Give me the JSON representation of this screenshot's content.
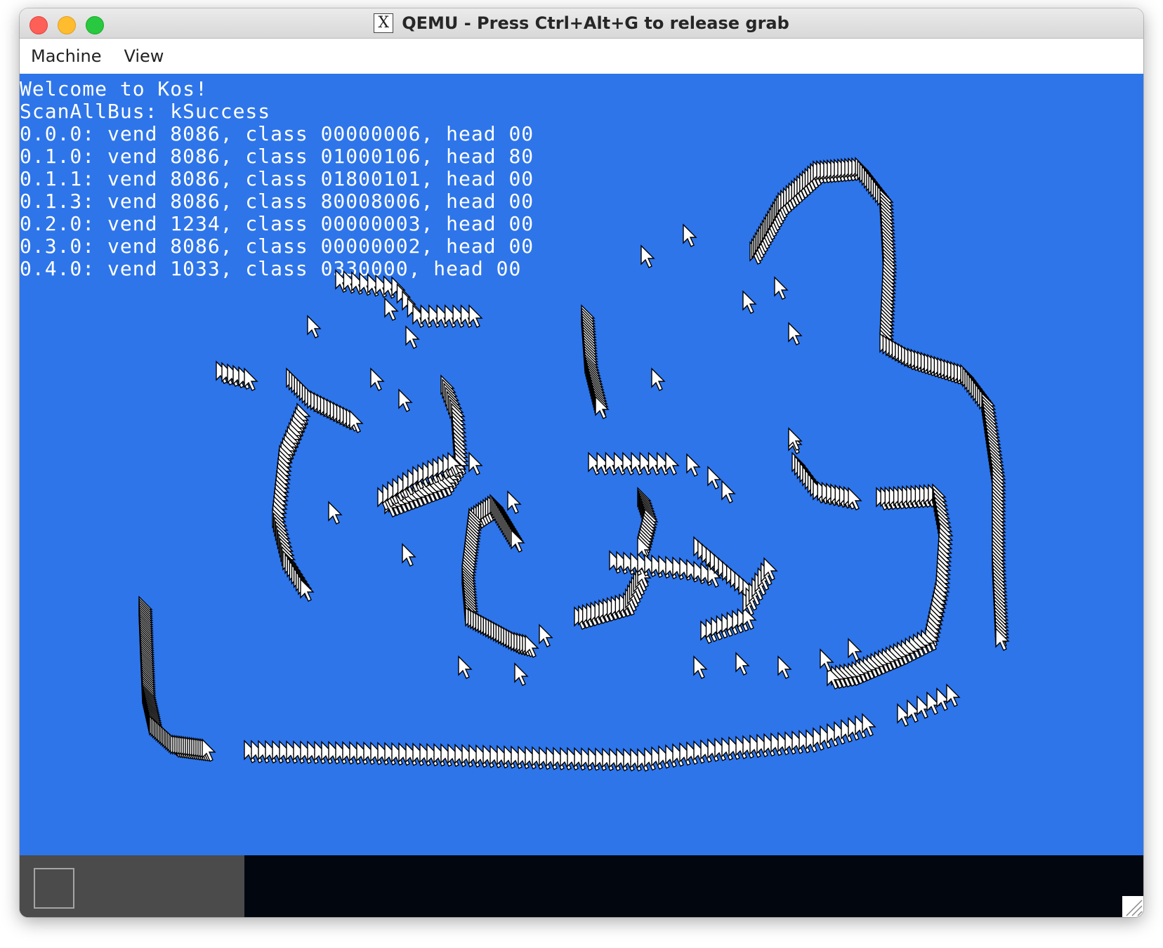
{
  "window": {
    "title": "QEMU - Press Ctrl+Alt+G to release grab",
    "x_icon_glyph": "X"
  },
  "menu": {
    "items": [
      "Machine",
      "View"
    ]
  },
  "console": {
    "lines": [
      "Welcome to Kos!",
      "ScanAllBus: kSuccess",
      "0.0.0: vend 8086, class 00000006, head 00",
      "0.1.0: vend 8086, class 01000106, head 80",
      "0.1.1: vend 8086, class 01800101, head 00",
      "0.1.3: vend 8086, class 80008006, head 00",
      "0.2.0: vend 1234, class 00000003, head 00",
      "0.3.0: vend 8086, class 00000002, head 00",
      "0.4.0: vend 1033, class 0330000, head 00"
    ]
  },
  "colors": {
    "screen_background": "#2e75ea",
    "console_text": "#ffffff",
    "taskbar": "#02070f",
    "task_panel": "#4b4b4b",
    "cursor_fill": "#ffffff",
    "cursor_outline": "#000000"
  },
  "icons": {
    "window_controls": [
      "close-icon",
      "minimize-icon",
      "maximize-icon"
    ],
    "app": "x-window-icon",
    "mouse_trail": "mouse-cursor-icon",
    "resize": "resize-grip-icon"
  }
}
